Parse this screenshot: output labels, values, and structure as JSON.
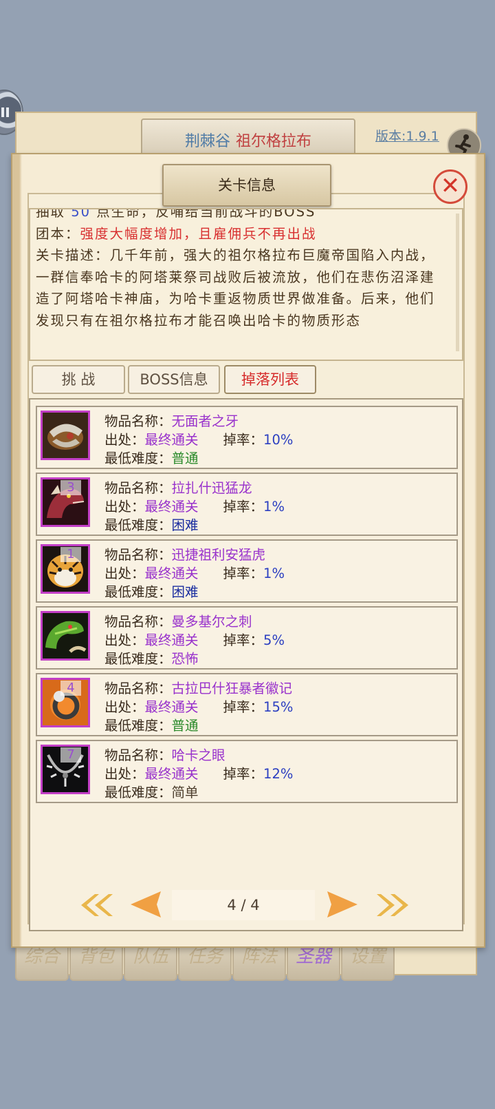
{
  "area": {
    "name": "荆棘谷",
    "boss": "祖尔格拉布"
  },
  "version": {
    "label": "版本:",
    "value": "1.9.1"
  },
  "dialog": {
    "title": "关卡信息"
  },
  "description": {
    "line0_prefix": "抽取",
    "line0_num": "50",
    "line0_suffix": "点生命，反哺给当前战斗的BOSS",
    "team_label": "团本：",
    "team_value": "强度大幅度增加，且雇佣兵不再出战",
    "desc_label": "关卡描述：",
    "desc_text": "几千年前，强大的祖尔格拉布巨魔帝国陷入内战，一群信奉哈卡的阿塔莱祭司战败后被流放，他们在悲伤沼泽建造了阿塔哈卡神庙，为哈卡重返物质世界做准备。后来，他们发现只有在祖尔格拉布才能召唤出哈卡的物质形态"
  },
  "tabs": [
    {
      "label": "挑 战",
      "active": false
    },
    {
      "label": "BOSS信息",
      "active": false
    },
    {
      "label": "掉落列表",
      "active": true
    }
  ],
  "labels": {
    "name": "物品名称：",
    "source": "出处：",
    "rate": "掉率：",
    "min_diff": "最低难度："
  },
  "items": [
    {
      "badge": "",
      "name": "无面者之牙",
      "source": "最终通关",
      "rate": "10%",
      "difficulty": "普通",
      "difficulty_color": "#2a8a2a",
      "icon": "fang-icon"
    },
    {
      "badge": "3",
      "name": "拉扎什迅猛龙",
      "source": "最终通关",
      "rate": "1%",
      "difficulty": "困难",
      "difficulty_color": "#1c2fa0",
      "icon": "raptor-icon"
    },
    {
      "badge": "1",
      "name": "迅捷祖利安猛虎",
      "source": "最终通关",
      "rate": "1%",
      "difficulty": "困难",
      "difficulty_color": "#1c2fa0",
      "icon": "tiger-icon"
    },
    {
      "badge": "",
      "name": "曼多基尔之刺",
      "source": "最终通关",
      "rate": "5%",
      "difficulty": "恐怖",
      "difficulty_color": "#9932cc",
      "icon": "snake-icon"
    },
    {
      "badge": "4",
      "name": "古拉巴什狂暴者徽记",
      "source": "最终通关",
      "rate": "15%",
      "difficulty": "普通",
      "difficulty_color": "#2a8a2a",
      "icon": "ring-icon"
    },
    {
      "badge": "7",
      "name": "哈卡之眼",
      "source": "最终通关",
      "rate": "12%",
      "difficulty": "简单",
      "difficulty_color": "#4e3f2e",
      "icon": "necklace-icon"
    }
  ],
  "pager": {
    "text": "4 / 4"
  },
  "nav": [
    {
      "label": "综合",
      "active": false
    },
    {
      "label": "背包",
      "active": false
    },
    {
      "label": "队伍",
      "active": false
    },
    {
      "label": "任务",
      "active": false
    },
    {
      "label": "阵法",
      "active": false
    },
    {
      "label": "圣器",
      "active": true
    },
    {
      "label": "设置",
      "active": false
    }
  ]
}
